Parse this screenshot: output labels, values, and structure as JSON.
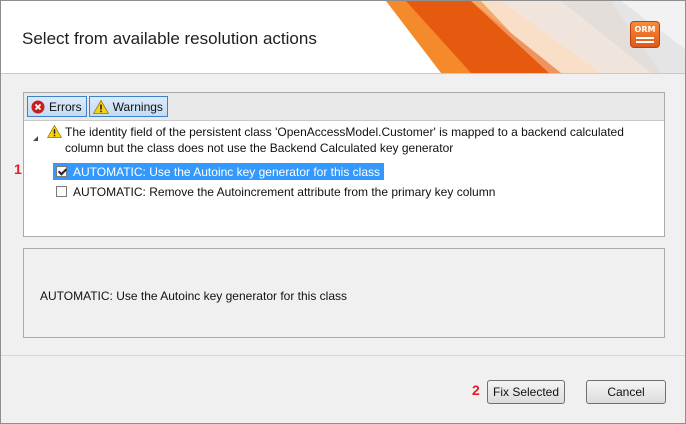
{
  "dialog": {
    "title": "Select from available resolution actions",
    "logo_text": "ORM"
  },
  "toolbar": {
    "errors_label": "Errors",
    "warnings_label": "Warnings"
  },
  "issue": {
    "text": "The identity field of the persistent class 'OpenAccessModel.Customer' is mapped to a backend calculated column but the class does not use the Backend Calculated key generator",
    "actions": [
      {
        "label": "AUTOMATIC: Use the Autoinc key generator for this class",
        "checked": true,
        "selected": true
      },
      {
        "label": "AUTOMATIC: Remove the Autoincrement attribute from the primary key column",
        "checked": false,
        "selected": false
      }
    ]
  },
  "description": {
    "text": "AUTOMATIC: Use the Autoinc key generator for this class"
  },
  "annotations": {
    "step1": "1",
    "step2": "2"
  },
  "buttons": {
    "fix_selected": "Fix Selected",
    "cancel": "Cancel"
  },
  "colors": {
    "selection": "#3399ff",
    "accent_orange": "#f26b1d",
    "annotation_red": "#e8192c"
  },
  "icons": {
    "errors": "error-icon",
    "warnings": "warning-icon",
    "logo": "orm-logo-icon"
  }
}
